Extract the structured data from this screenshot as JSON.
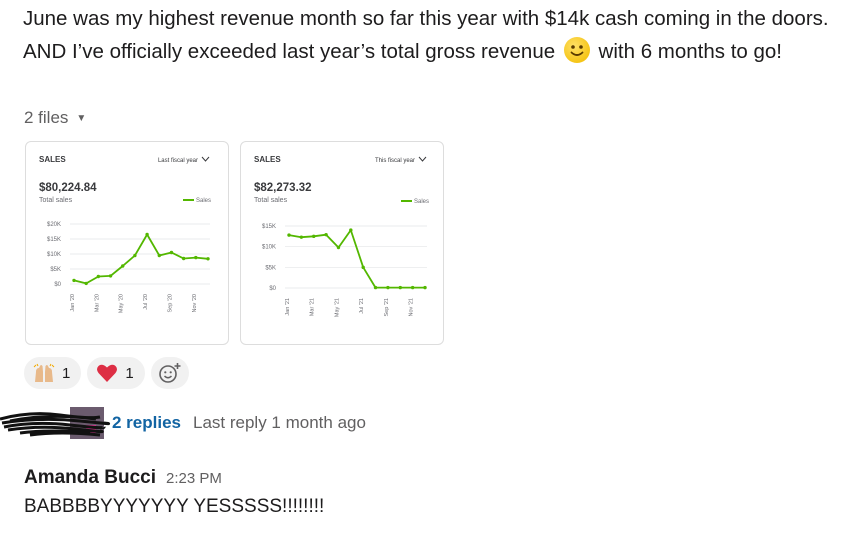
{
  "message": {
    "text_before_emoji": "June was my highest revenue month so far this year with $14k cash coming in the doors. AND I’ve officially exceeded last year’s total gross revenue",
    "text_after_emoji": " with 6 months to go!",
    "emoji": "slightly-smiling-face"
  },
  "files": {
    "toggle_label": "2 files",
    "cards": [
      {
        "header": "SALES",
        "period_select": "Last fiscal year",
        "total": "$80,224.84",
        "total_label": "Total sales",
        "legend": "Sales",
        "y_ticks": [
          "$20K",
          "$15K",
          "$10K",
          "$5K",
          "$0"
        ],
        "x_ticks": [
          "Jan '20",
          "Mar '20",
          "May '20",
          "Jul '20",
          "Sep '20",
          "Nov '20"
        ]
      },
      {
        "header": "SALES",
        "period_select": "This fiscal year",
        "total": "$82,273.32",
        "total_label": "Total sales",
        "legend": "Sales",
        "y_ticks": [
          "$15K",
          "$10K",
          "$5K",
          "$0"
        ],
        "x_ticks": [
          "Jan '21",
          "Mar '21",
          "May '21",
          "Jul '21",
          "Sep '21",
          "Nov '21"
        ]
      }
    ]
  },
  "chart_data": [
    {
      "type": "line",
      "x": [
        "Jan '20",
        "Feb '20",
        "Mar '20",
        "Apr '20",
        "May '20",
        "Jun '20",
        "Jul '20",
        "Aug '20",
        "Sep '20",
        "Oct '20",
        "Nov '20",
        "Dec '20"
      ],
      "series": [
        {
          "name": "Sales",
          "values": [
            1200,
            200,
            2500,
            2700,
            6000,
            9500,
            16500,
            9500,
            10500,
            8500,
            8800,
            8400
          ]
        }
      ],
      "title": "",
      "xlabel": "",
      "ylabel": "",
      "ylim": [
        0,
        20000
      ],
      "color": "#53b700",
      "legend": "top-right"
    },
    {
      "type": "line",
      "x": [
        "Jan '21",
        "Feb '21",
        "Mar '21",
        "Apr '21",
        "May '21",
        "Jun '21",
        "Jul '21",
        "Aug '21",
        "Sep '21",
        "Oct '21",
        "Nov '21",
        "Dec '21"
      ],
      "series": [
        {
          "name": "Sales",
          "values": [
            12800,
            12300,
            12500,
            12900,
            9800,
            14000,
            5000,
            100,
            100,
            100,
            100,
            100
          ]
        }
      ],
      "title": "",
      "xlabel": "",
      "ylabel": "",
      "ylim": [
        0,
        15000
      ],
      "color": "#53b700",
      "legend": "top-right"
    }
  ],
  "reactions": [
    {
      "emoji": "raised-hands",
      "count": "1"
    },
    {
      "emoji": "red-heart",
      "count": "1"
    }
  ],
  "thread": {
    "replies": "2 replies",
    "last_reply": "Last reply 1 month ago"
  },
  "reply": {
    "author": "Amanda Bucci",
    "time": "2:23 PM",
    "text": "BABBBBYYYYYYY YESSSSS!!!!!!!!"
  }
}
